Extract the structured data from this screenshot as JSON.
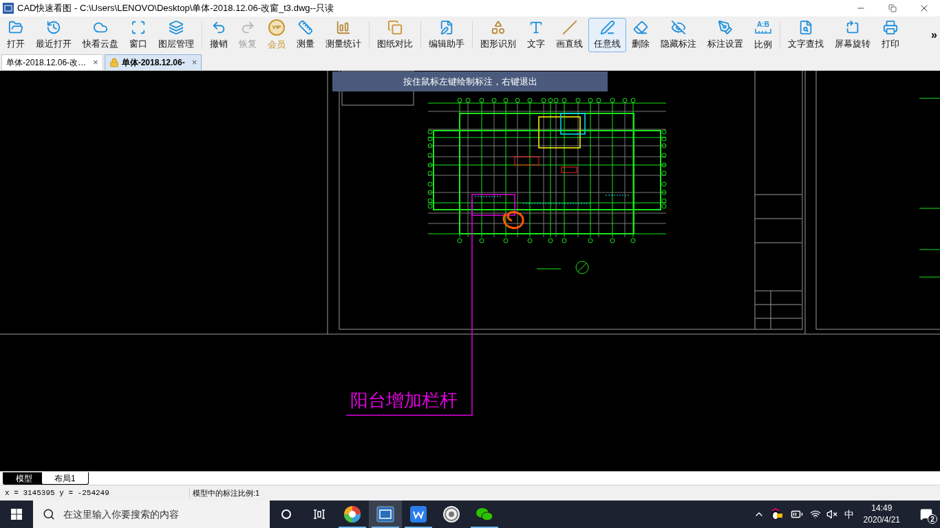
{
  "window": {
    "title": "CAD快速看图 - C:\\Users\\LENOVO\\Desktop\\单体-2018.12.06-改窗_t3.dwg--只读"
  },
  "toolbar": {
    "groups": [
      {
        "items": [
          {
            "label": "打开",
            "kind": "tool",
            "disabled": false,
            "selected": false
          },
          {
            "label": "最近打开",
            "kind": "tool",
            "disabled": false,
            "selected": false
          },
          {
            "label": "快看云盘",
            "kind": "tool",
            "disabled": false,
            "selected": false
          },
          {
            "label": "窗口",
            "kind": "tool",
            "disabled": false,
            "selected": false
          },
          {
            "label": "图层管理",
            "kind": "tool",
            "disabled": false,
            "selected": false
          }
        ]
      },
      {
        "items": [
          {
            "label": "撤销",
            "kind": "tool",
            "disabled": false,
            "selected": false
          },
          {
            "label": "恢复",
            "kind": "tool",
            "disabled": true,
            "selected": false
          },
          {
            "label": "会员",
            "kind": "vip",
            "badge": "VIP",
            "disabled": false,
            "selected": false
          },
          {
            "label": "测量",
            "kind": "tool",
            "disabled": false,
            "selected": false
          },
          {
            "label": "测量统计",
            "kind": "tool",
            "disabled": false,
            "selected": false
          }
        ]
      },
      {
        "items": [
          {
            "label": "图纸对比",
            "kind": "tool",
            "disabled": false,
            "selected": false
          }
        ]
      },
      {
        "items": [
          {
            "label": "编辑助手",
            "kind": "tool",
            "disabled": false,
            "selected": false
          }
        ]
      },
      {
        "items": [
          {
            "label": "图形识别",
            "kind": "tool",
            "disabled": false,
            "selected": false
          },
          {
            "label": "文字",
            "kind": "tool",
            "disabled": false,
            "selected": false
          },
          {
            "label": "画直线",
            "kind": "tool",
            "disabled": false,
            "selected": false
          },
          {
            "label": "任意线",
            "kind": "tool",
            "disabled": false,
            "selected": true
          },
          {
            "label": "删除",
            "kind": "tool",
            "disabled": false,
            "selected": false
          },
          {
            "label": "隐藏标注",
            "kind": "tool",
            "disabled": false,
            "selected": false
          },
          {
            "label": "标注设置",
            "kind": "tool",
            "disabled": false,
            "selected": false
          },
          {
            "label": "比例",
            "kind": "scale",
            "badge": "A:B",
            "disabled": false,
            "selected": false
          }
        ]
      },
      {
        "items": [
          {
            "label": "文字查找",
            "kind": "tool",
            "disabled": false,
            "selected": false
          },
          {
            "label": "屏幕旋转",
            "kind": "tool",
            "disabled": false,
            "selected": false
          },
          {
            "label": "打印",
            "kind": "tool",
            "disabled": false,
            "selected": false
          }
        ]
      }
    ],
    "overflow": "»"
  },
  "document_tabs": [
    {
      "label": "单体-2018.12.06-改…",
      "selected": false,
      "locked": false,
      "close": "×"
    },
    {
      "label": "单体-2018.12.06-",
      "selected": true,
      "locked": true,
      "close": "×"
    }
  ],
  "canvas": {
    "hint": "按住鼠标左键绘制标注，右键退出",
    "annotation": "阳台增加栏杆"
  },
  "layout_tabs": [
    {
      "label": "模型",
      "selected": true
    },
    {
      "label": "布局1",
      "selected": false
    }
  ],
  "status_bar": {
    "coordinates": "x = 3145395 y = -254249",
    "scale": "模型中的标注比例:1"
  },
  "taskbar": {
    "search_placeholder": "在这里输入你要搜索的内容",
    "apps": [
      {
        "kind": "pinwheel",
        "selected": false,
        "running": true
      },
      {
        "kind": "cad",
        "selected": true,
        "running": true
      },
      {
        "kind": "wps",
        "selected": false,
        "running": true
      },
      {
        "kind": "seal",
        "selected": false,
        "running": false
      },
      {
        "kind": "wechat",
        "selected": false,
        "running": true
      }
    ],
    "ime": "中",
    "time": "14:49",
    "date": "2020/4/21",
    "notifications": "2"
  }
}
